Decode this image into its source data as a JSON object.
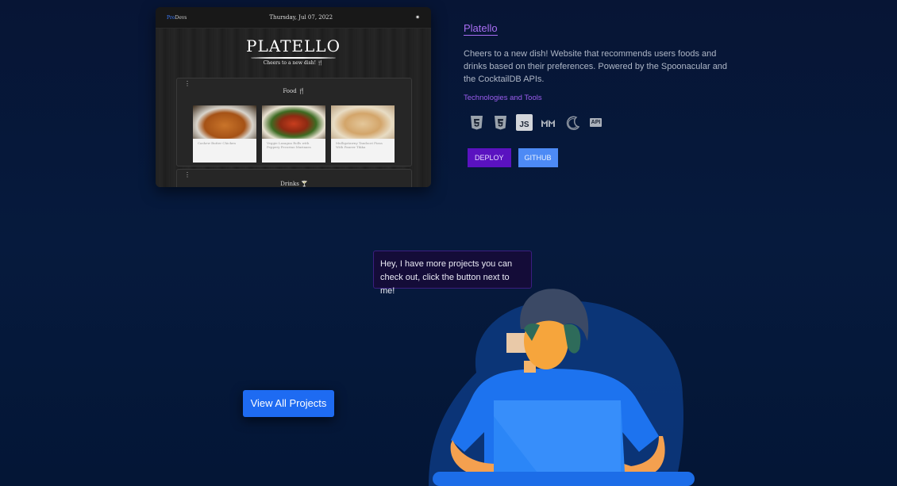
{
  "preview": {
    "brand_prefix": "Pro",
    "brand_suffix": "Devs",
    "date": "Thursday, Jul 07, 2022",
    "title": "PLATELLO",
    "subtitle": "Cheers to a new dish! 🍴",
    "food_section": "Food 🍴",
    "drinks_section": "Drinks 🍸",
    "foods": [
      {
        "name": "Cashew Butter Chicken"
      },
      {
        "name": "Veggie Lasagna Rolls with Peppery Pecorino Marinara"
      },
      {
        "name": "Mulligatawny Tandoori Pizza With Paneer Tikka"
      }
    ]
  },
  "project": {
    "title": "Platello",
    "description": "Cheers to a new dish! Website that recommends users foods and drinks based on their preferences. Powered by the Spoonacular and the CocktailDB APIs.",
    "tech_label": "Technologies and Tools",
    "tech_icons": [
      "html5-icon",
      "css3-icon",
      "javascript-icon",
      "material-ui-icon",
      "moon-icon",
      "api-icon"
    ],
    "tech_api_text": "API",
    "tech_js_text": "JS",
    "deploy_label": "DEPLOY",
    "github_label": "GITHUB"
  },
  "callout": {
    "text": "Hey, I have more projects you can check out, click the button next to me!"
  },
  "view_all_label": "View All Projects",
  "colors": {
    "accent_purple": "#a86ef3",
    "deploy_bg": "#5a12c0",
    "github_bg": "#4d8af5",
    "view_btn_bg": "#1e6bf2"
  }
}
